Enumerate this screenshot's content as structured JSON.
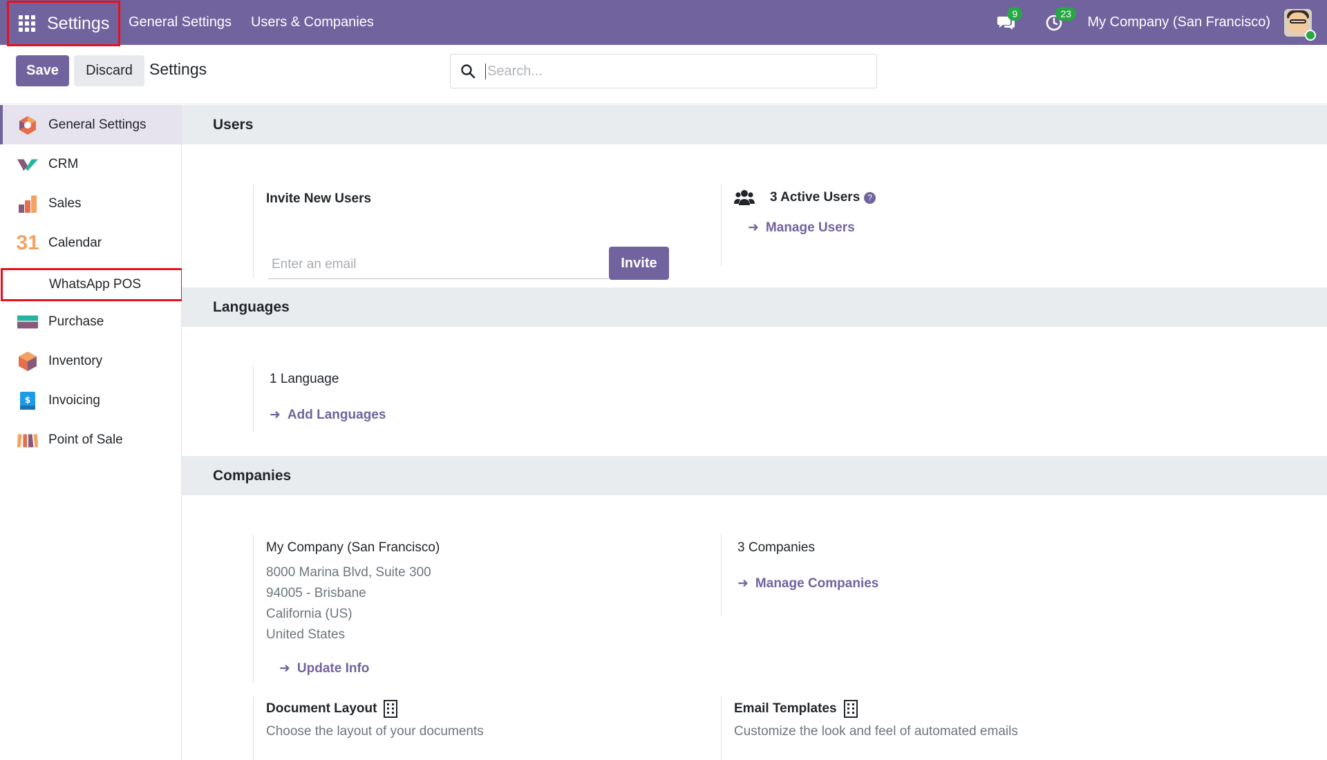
{
  "navbar": {
    "app_name": "Settings",
    "menu": [
      "General Settings",
      "Users & Companies"
    ],
    "messages_count": "9",
    "activities_count": "23",
    "company": "My Company (San Francisco)"
  },
  "control_panel": {
    "save_label": "Save",
    "discard_label": "Discard",
    "title": "Settings",
    "search_placeholder": "Search..."
  },
  "sidebar": {
    "items": [
      {
        "label": "General Settings"
      },
      {
        "label": "CRM"
      },
      {
        "label": "Sales"
      },
      {
        "label": "Calendar"
      },
      {
        "label": "WhatsApp POS"
      },
      {
        "label": "Purchase"
      },
      {
        "label": "Inventory"
      },
      {
        "label": "Invoicing"
      },
      {
        "label": "Point of Sale"
      }
    ],
    "calendar_icon_text": "31"
  },
  "users": {
    "header": "Users",
    "invite_title": "Invite New Users",
    "email_placeholder": "Enter an email",
    "invite_label": "Invite",
    "active_users": "3 Active Users",
    "manage_users": "Manage Users"
  },
  "languages": {
    "header": "Languages",
    "count": "1 Language",
    "add_languages": "Add Languages"
  },
  "companies": {
    "header": "Companies",
    "company_name": "My Company (San Francisco)",
    "address_line1": "8000 Marina Blvd, Suite 300",
    "address_line2": "94005 - Brisbane",
    "address_line3": "California (US)",
    "address_line4": "United States",
    "update_info": "Update Info",
    "companies_count": "3 Companies",
    "manage_companies": "Manage Companies",
    "document_layout_title": "Document Layout",
    "document_layout_desc": "Choose the layout of your documents",
    "email_templates_title": "Email Templates",
    "email_templates_desc": "Customize the look and feel of automated emails"
  },
  "colors": {
    "brand": "#71639e",
    "badge": "#28a745",
    "highlight": "#e8101c"
  }
}
